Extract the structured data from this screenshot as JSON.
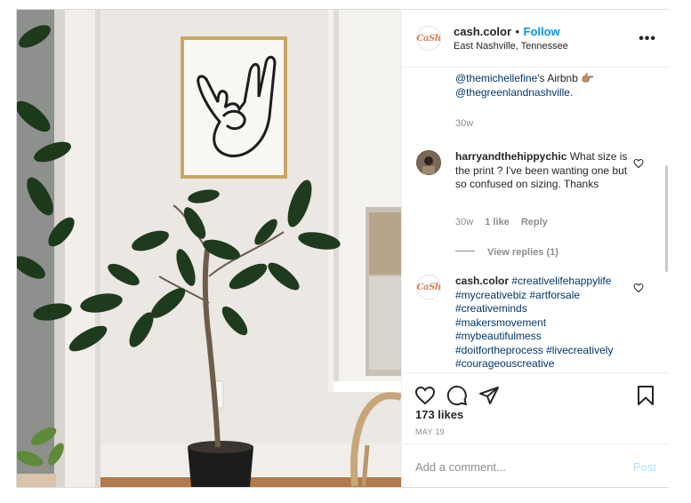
{
  "header": {
    "avatar_text": "CaSh",
    "username": "cash.color",
    "separator": "•",
    "follow": "Follow",
    "location": "East Nashville, Tennessee",
    "more": "•••"
  },
  "caption_tail": {
    "line1_link": "@themichellefine",
    "line1_text": "'s Airbnb 👉🏽",
    "line2_link": "@thegreenlandnashville",
    "line2_text": ".",
    "time": "30w"
  },
  "comment1": {
    "username": "harryandthehippychic",
    "text": " What size is the print ? I've been wanting one but so confused on sizing. Thanks",
    "time": "30w",
    "likes": "1 like",
    "reply": "Reply",
    "view_replies": "View replies (1)"
  },
  "comment2": {
    "username": "cash.color",
    "hashtags": [
      "#creativelifehappylife",
      "#mycreativebiz",
      "#artforsale",
      "#creativeminds",
      "#makersmovement",
      "#mybeautifulmess",
      "#doitfortheprocess",
      "#livecreatively",
      "#courageouscreative"
    ]
  },
  "actions": {
    "likes": "173 likes",
    "date": "MAY 19"
  },
  "add_comment": {
    "placeholder": "Add a comment...",
    "post": "Post"
  },
  "icons": {
    "like": "heart-icon",
    "comment": "comment-icon",
    "share": "share-icon",
    "save": "bookmark-icon"
  },
  "colors": {
    "link": "#00376b",
    "follow": "#0095f6",
    "muted": "#8e8e8e",
    "post_disabled": "#b2dffc"
  }
}
